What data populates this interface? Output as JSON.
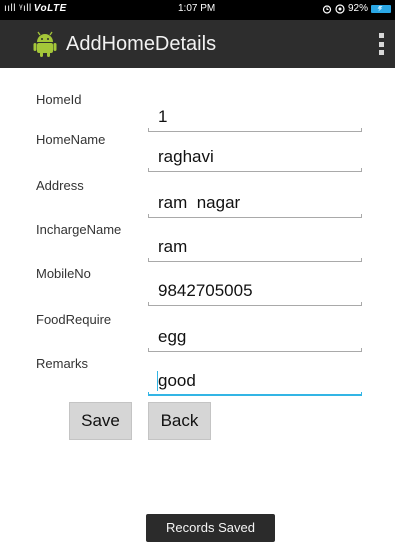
{
  "status_bar": {
    "signal": "ııll ᵞıll",
    "network": "VoLTE",
    "time": "1:07 PM",
    "battery": "92%"
  },
  "action_bar": {
    "title": "AddHomeDetails"
  },
  "form": {
    "fields": [
      {
        "label": "HomeId",
        "value": "1"
      },
      {
        "label": "HomeName",
        "value": "raghavi"
      },
      {
        "label": "Address",
        "value": "ram  nagar"
      },
      {
        "label": "InchargeName",
        "value": "ram"
      },
      {
        "label": "MobileNo",
        "value": "9842705005"
      },
      {
        "label": "FoodRequire",
        "value": "egg"
      },
      {
        "label": "Remarks",
        "value": "good"
      }
    ]
  },
  "buttons": {
    "save": "Save",
    "back": "Back"
  },
  "toast": {
    "message": "Records Saved"
  },
  "colors": {
    "accent": "#33b5e5",
    "action_bar": "#2d2d2d",
    "android_icon": "#a4c639",
    "toast_bg": "#2b2b2b"
  }
}
